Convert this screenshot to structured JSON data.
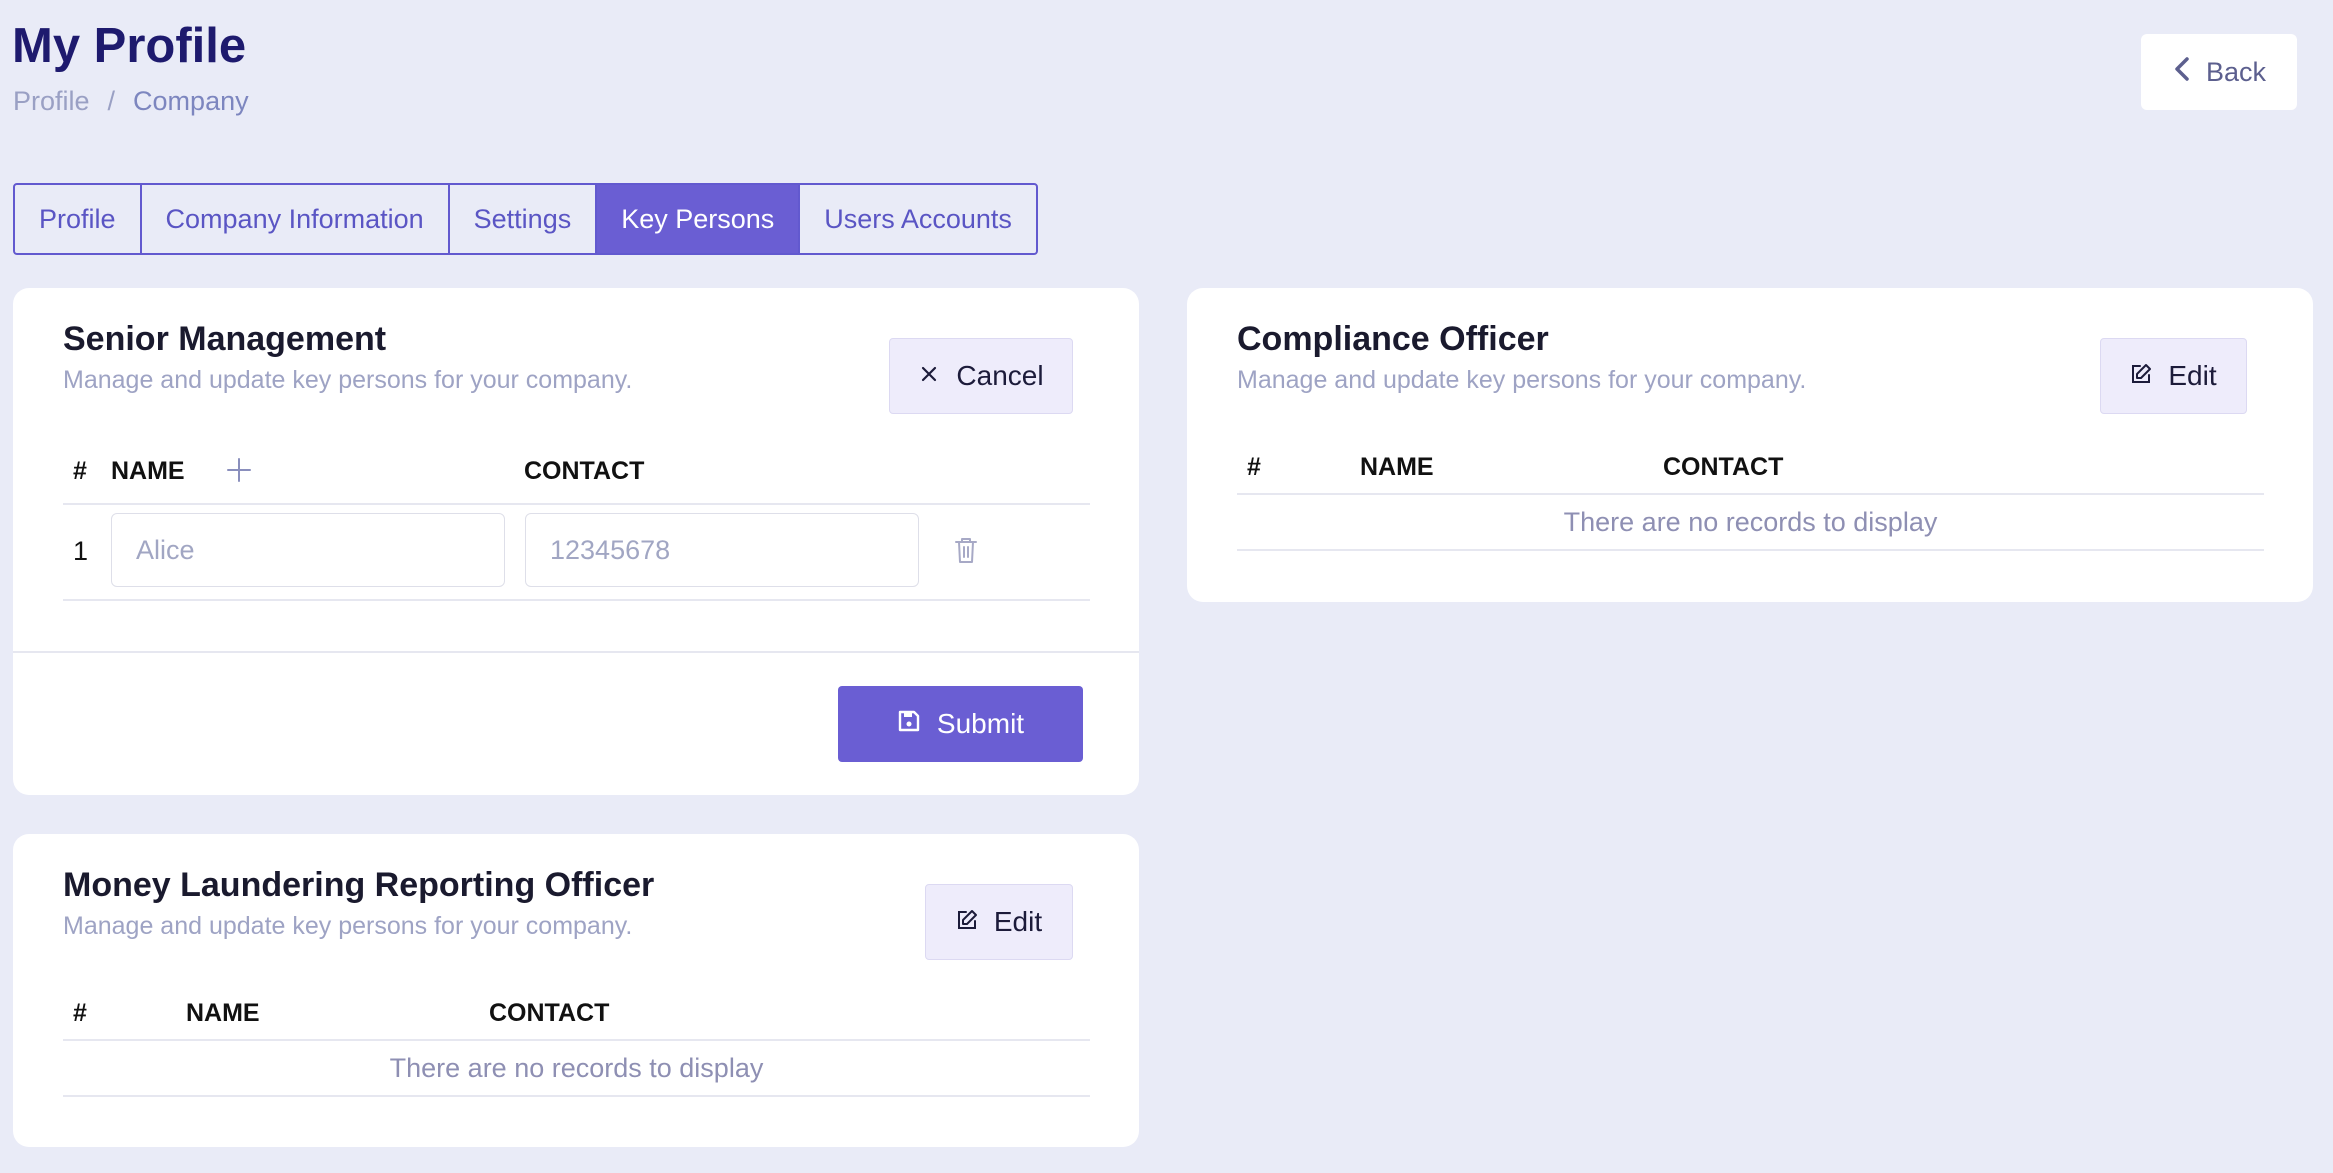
{
  "header": {
    "title": "My Profile",
    "breadcrumb": [
      "Profile",
      "Company"
    ],
    "breadcrumb_separator": "/",
    "back_label": "Back"
  },
  "tabs": [
    {
      "label": "Profile",
      "active": false
    },
    {
      "label": "Company Information",
      "active": false
    },
    {
      "label": "Settings",
      "active": false
    },
    {
      "label": "Key Persons",
      "active": true
    },
    {
      "label": "Users Accounts",
      "active": false
    }
  ],
  "senior_management": {
    "title": "Senior Management",
    "subtitle": "Manage and update key persons for your company.",
    "cancel_label": "Cancel",
    "columns": {
      "num": "#",
      "name": "NAME",
      "contact": "CONTACT"
    },
    "rows": [
      {
        "num": "1",
        "name_placeholder": "Alice",
        "contact_placeholder": "12345678"
      }
    ],
    "submit_label": "Submit"
  },
  "compliance_officer": {
    "title": "Compliance Officer",
    "subtitle": "Manage and update key persons for your company.",
    "edit_label": "Edit",
    "columns": {
      "num": "#",
      "name": "NAME",
      "contact": "CONTACT"
    },
    "empty": "There are no records to display"
  },
  "mlro": {
    "title": "Money Laundering Reporting Officer",
    "subtitle": "Manage and update key persons for your company.",
    "edit_label": "Edit",
    "columns": {
      "num": "#",
      "name": "NAME",
      "contact": "CONTACT"
    },
    "empty": "There are no records to display"
  },
  "colors": {
    "background": "#e9ebf7",
    "accent": "#6a5ed3",
    "title": "#1e1a6e"
  },
  "icons": [
    "chevron-left-icon",
    "close-icon",
    "plus-icon",
    "trash-icon",
    "save-icon",
    "edit-icon"
  ]
}
